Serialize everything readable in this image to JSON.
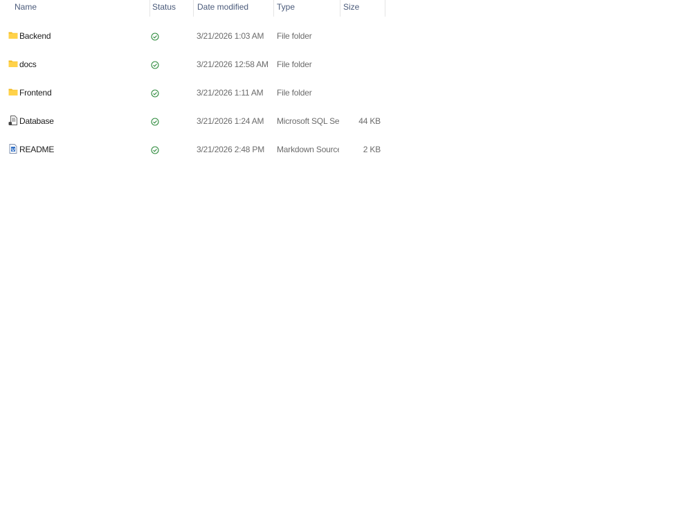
{
  "columns": {
    "name": "Name",
    "status": "Status",
    "date": "Date modified",
    "type": "Type",
    "size": "Size"
  },
  "rows": [
    {
      "icon": "folder-icon",
      "name": "Backend",
      "status": "synced",
      "date": "3/21/2026 1:03 AM",
      "type": "File folder",
      "size": ""
    },
    {
      "icon": "folder-icon",
      "name": "docs",
      "status": "synced",
      "date": "3/21/2026 12:58 AM",
      "type": "File folder",
      "size": ""
    },
    {
      "icon": "folder-icon",
      "name": "Frontend",
      "status": "synced",
      "date": "3/21/2026 1:11 AM",
      "type": "File folder",
      "size": ""
    },
    {
      "icon": "sql-file-icon",
      "name": "Database",
      "status": "synced",
      "date": "3/21/2026 1:24 AM",
      "type": "Microsoft SQL Ser...",
      "size": "44 KB"
    },
    {
      "icon": "markdown-file-icon",
      "name": "README",
      "status": "synced",
      "date": "3/21/2026 2:48 PM",
      "type": "Markdown Source ...",
      "size": "2 KB"
    }
  ],
  "colors": {
    "status_ok": "#2e8b3d",
    "folder": "#f4c430",
    "header_text": "#4a5a7a"
  }
}
